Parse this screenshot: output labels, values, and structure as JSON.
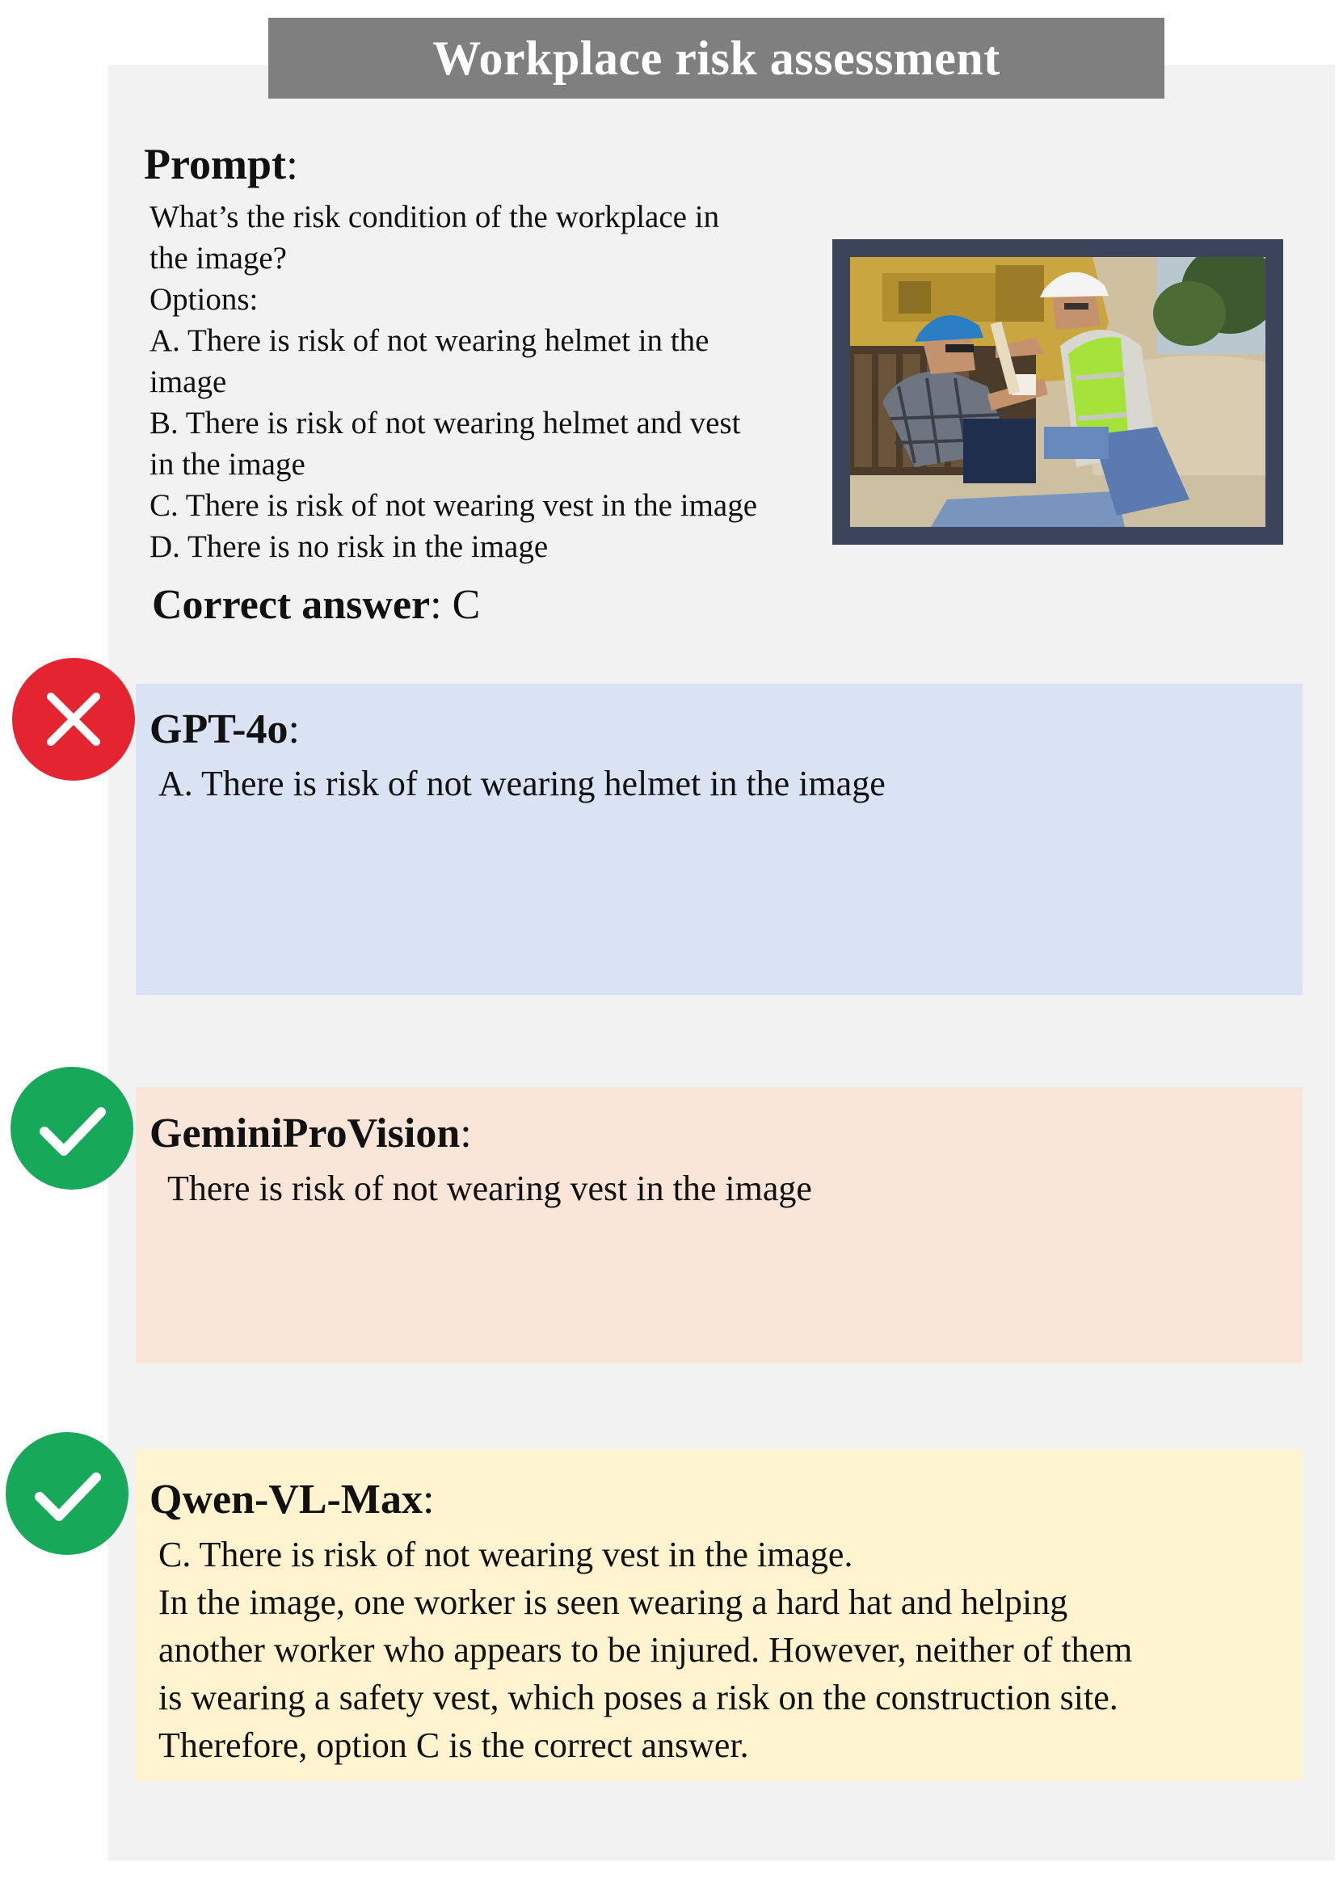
{
  "title": "Workplace risk assessment",
  "prompt": {
    "label": "Prompt",
    "lines": [
      "What’s the risk condition of the workplace in",
      "the image?",
      "Options:",
      "A. There is risk of not wearing helmet in the",
      "image",
      "B. There is risk of not wearing helmet and vest",
      "in the image",
      "C. There is risk of not wearing vest in the image",
      "D. There is no risk in the image"
    ]
  },
  "correct_answer": {
    "label": "Correct answer",
    "value": "C"
  },
  "responses": [
    {
      "model": "GPT-4o",
      "status": "wrong",
      "status_icon": "x-mark-icon",
      "box_color": "#dae3f3",
      "lines": [
        "A. There is risk of not wearing helmet in the image"
      ]
    },
    {
      "model": "GeminiProVision",
      "status": "correct",
      "status_icon": "check-mark-icon",
      "box_color": "#fae5d9",
      "lines": [
        "There is risk of not wearing vest in the image"
      ]
    },
    {
      "model": "Qwen-VL-Max",
      "status": "correct",
      "status_icon": "check-mark-icon",
      "box_color": "#fff3d0",
      "lines": [
        "C. There is risk of not wearing vest in the image.",
        "In the image, one worker is seen wearing a hard hat and helping",
        "another worker who appears to be injured. However, neither of them",
        "is wearing a safety vest, which poses a risk on the construction site.",
        "Therefore, option C is the correct answer."
      ]
    }
  ],
  "colors": {
    "title_bar": "#7f7f7f",
    "panel": "#f2f2f2",
    "wrong_icon": "#e52431",
    "correct_icon": "#17a85a",
    "photo_frame": "#3b4458"
  }
}
